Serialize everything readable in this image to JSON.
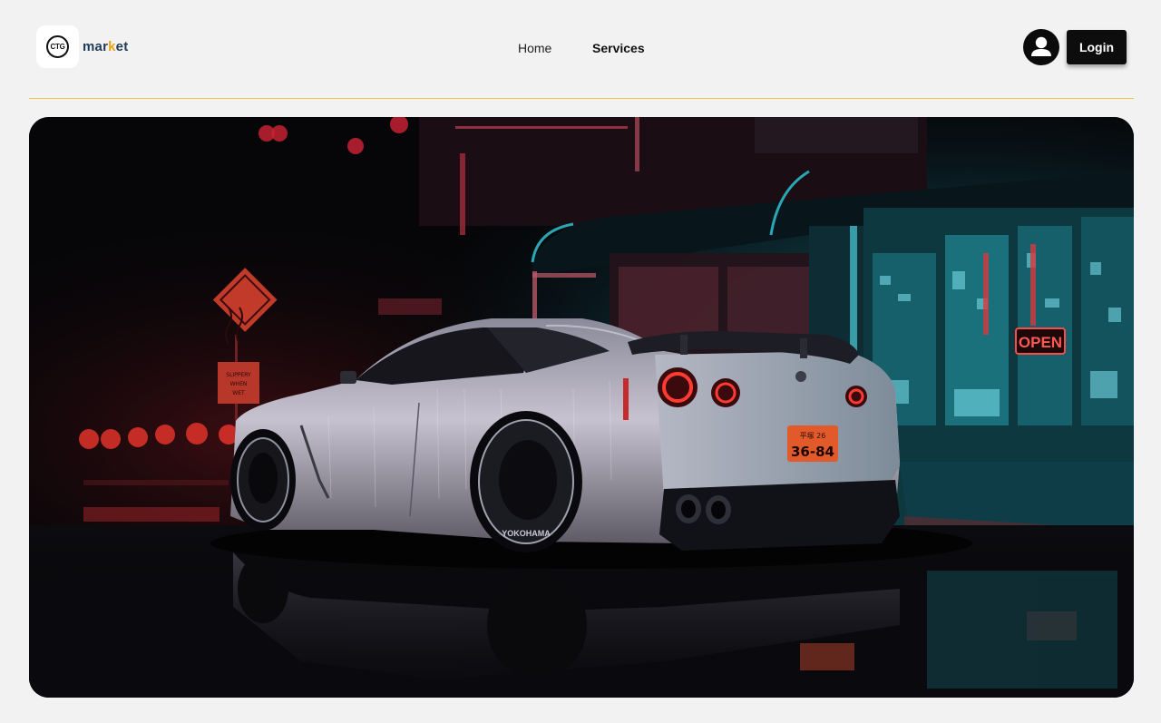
{
  "header": {
    "logo_text": "CTG",
    "brand_prefix": "mar",
    "brand_accent": "k",
    "brand_suffix": "et",
    "nav": [
      {
        "label": "Home"
      },
      {
        "label": "Services"
      }
    ],
    "login_label": "Login"
  },
  "hero": {
    "sign_text": "SLIPPERY WHEN WET",
    "open_sign": "OPEN",
    "plate_top": "平塚 26",
    "plate_number": "36-84",
    "tire_brand": "YOKOHAMA"
  },
  "colors": {
    "background": "#f2f2f2",
    "divider": "#f0c34a",
    "brand": "#1f3b57",
    "brand_accent": "#e8a317",
    "button": "#0d0d0d"
  }
}
